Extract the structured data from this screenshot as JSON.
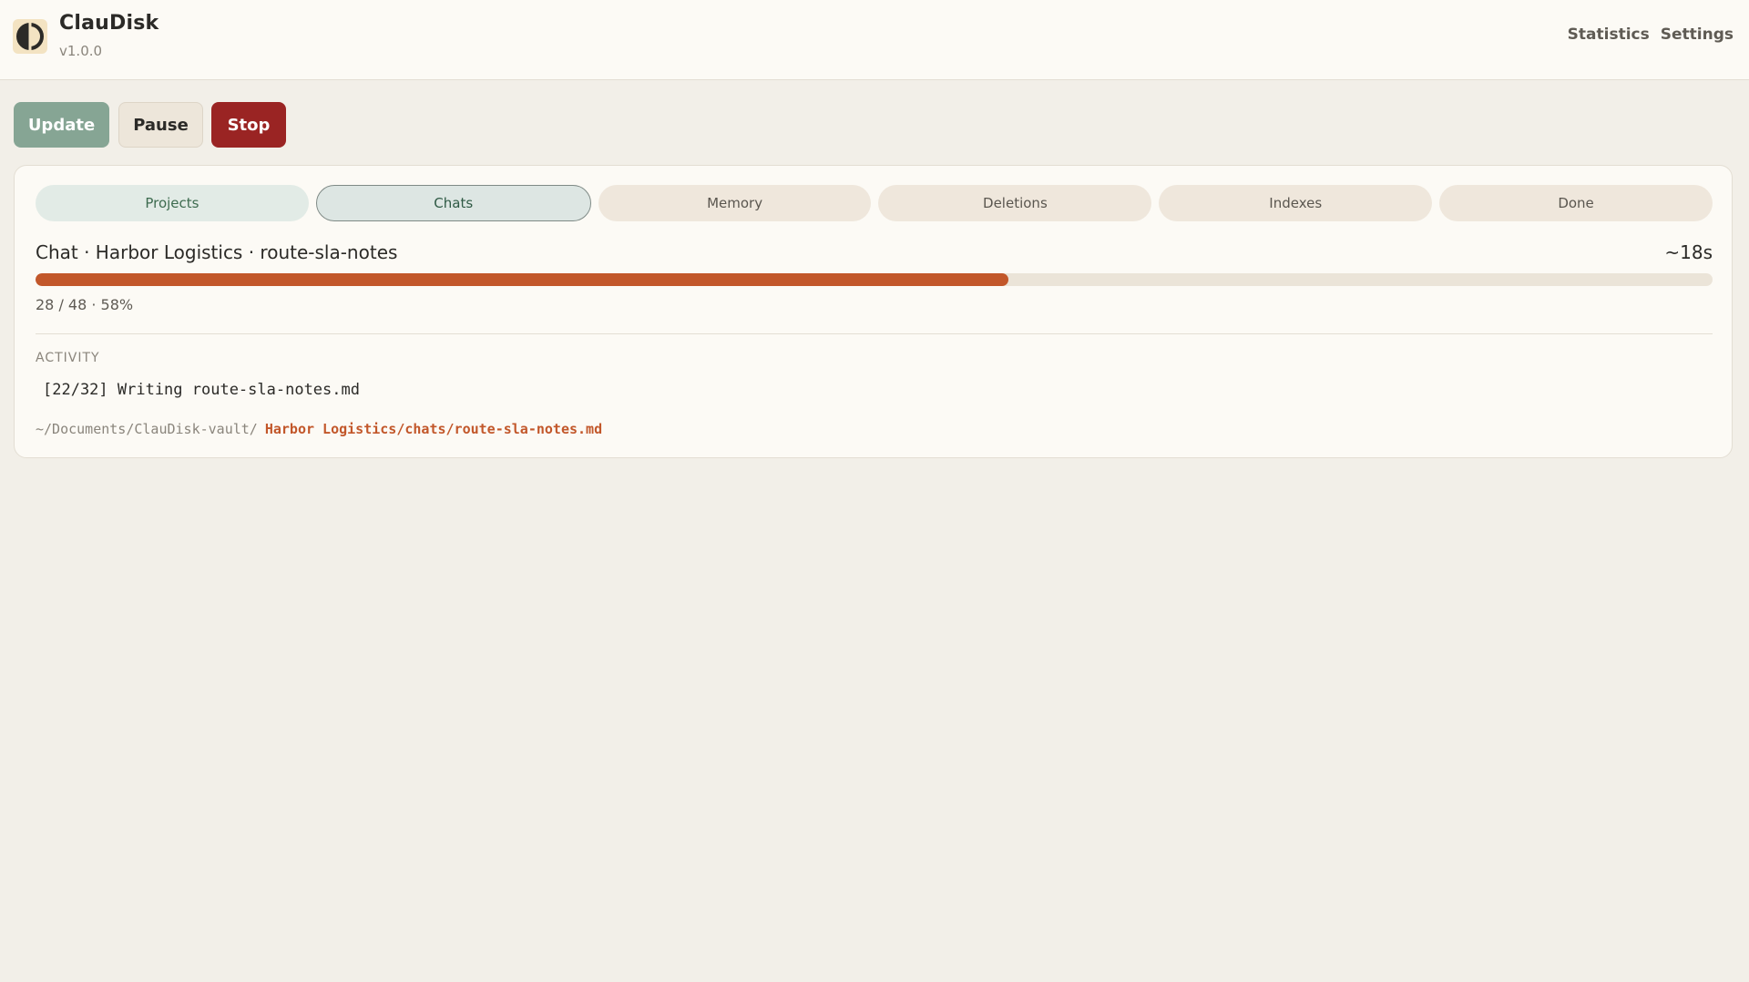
{
  "app": {
    "title": "ClauDisk",
    "version": "v1.0.0",
    "logo_icon": "split-circle-logo-icon"
  },
  "nav": {
    "statistics_label": "Statistics",
    "settings_label": "Settings"
  },
  "actions": {
    "update_label": "Update",
    "pause_label": "Pause",
    "stop_label": "Stop"
  },
  "colors": {
    "update": "#86a594",
    "stop": "#9a2423",
    "progress": "#c2572a",
    "path_highlight": "#c2572a"
  },
  "tabs": [
    {
      "label": "Projects",
      "state": "done"
    },
    {
      "label": "Chats",
      "state": "active"
    },
    {
      "label": "Memory",
      "state": "pending"
    },
    {
      "label": "Deletions",
      "state": "pending"
    },
    {
      "label": "Indexes",
      "state": "pending"
    },
    {
      "label": "Done",
      "state": "pending"
    }
  ],
  "progress": {
    "label": "Chat · Harbor Logistics · route-sla-notes",
    "eta": "~18s",
    "fraction": 0.58,
    "stats": "28 / 48 · 58%"
  },
  "activity": {
    "heading": "ACTIVITY",
    "line": "[22/32] Writing route-sla-notes.md",
    "path_base": "~/Documents/ClauDisk-vault/",
    "path_file": "Harbor Logistics/chats/route-sla-notes.md"
  }
}
